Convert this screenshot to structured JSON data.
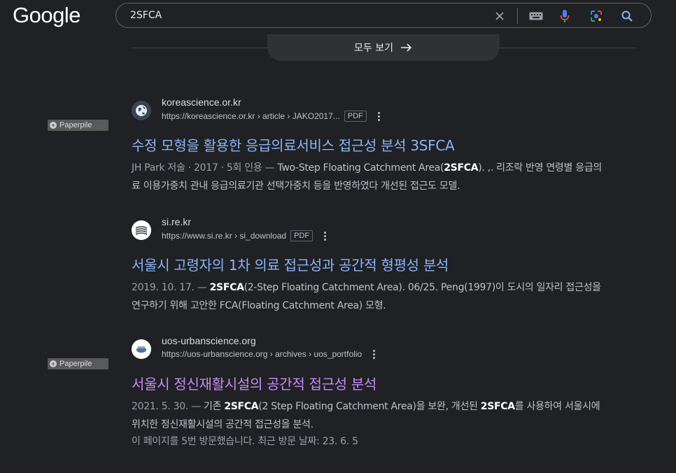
{
  "header": {
    "logo": "Google",
    "search_query": "2SFCA"
  },
  "see_all": {
    "label": "모두 보기"
  },
  "paperpile_label": "Paperpile",
  "results": [
    {
      "site": "koreascience.or.kr",
      "breadcrumb": "https://koreascience.or.kr › article › JAKO2017...",
      "badge": "PDF",
      "title": "수정 모형을 활용한 응급의료서비스 접근성 분석 3SFCA",
      "visited": false,
      "meta": "JH Park 저술 · 2017 · 5회 인용 — ",
      "snippet_parts": [
        "Two-Step Floating Catchment Area(",
        "2SFCA",
        "). ,. 리조락 반영 연령별 응급의료 이용가중치 관내 응급의료기관 선택가중치 등을 반영하였다 개선된 접근도 모델."
      ]
    },
    {
      "site": "si.re.kr",
      "breadcrumb": "https://www.si.re.kr › si_download",
      "badge": "PDF",
      "title": "서울시 고령자의 1차 의료 접근성과 공간적 형평성 분석",
      "visited": false,
      "meta": "2019. 10. 17. — ",
      "snippet_parts": [
        "2SFCA",
        "(2-Step Floating Catchment Area). 06/25. Peng(1997)이 도시의 일자리 접근성을 연구하기 위해 고안한 FCA(Floating Catchment Area) 모형."
      ]
    },
    {
      "site": "uos-urbanscience.org",
      "breadcrumb": "https://uos-urbanscience.org › archives › uos_portfolio",
      "title": "서울시 정신재활시설의 공간적 접근성 분석",
      "visited": true,
      "meta": "2021. 5. 30. — ",
      "snippet_parts": [
        "기존 ",
        "2SFCA",
        "(2 Step Floating Catchment Area)을 보완, 개선된 ",
        "2SFCA",
        "를 사용하여 서울시에 위치한 정신재활시설의 공간적 접근성을 분석."
      ],
      "visit_info": "이 페이지를 5번 방문했습니다. 최근 방문 날짜: 23. 6. 5"
    }
  ],
  "colors": {
    "background": "#202124",
    "link": "#8ab4f8",
    "visited_link": "#c58af9"
  }
}
